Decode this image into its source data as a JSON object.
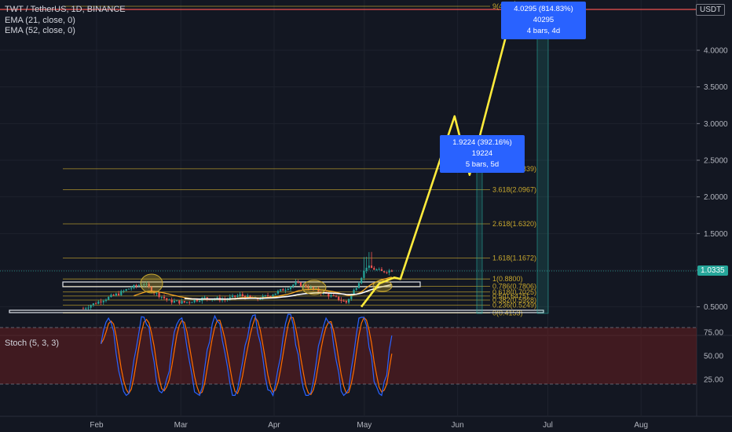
{
  "header": {
    "symbol_line": "TWT / TetherUS, 1D, BINANCE",
    "ema21": "EMA (21, close, 0)",
    "ema52": "EMA (52, close, 0)",
    "stoch_label": "Stoch (5, 3, 3)",
    "currency_badge": "USDT",
    "last_price": "1.0335"
  },
  "measures": [
    {
      "line1": "4.0295 (814.83%) 40295",
      "line2": "4 bars, 4d"
    },
    {
      "line1": "1.9224 (392.16%) 19224",
      "line2": "5 bars, 5d"
    }
  ],
  "colors": {
    "background": "#131722",
    "up": "#26a69a",
    "down": "#ef5350",
    "fib": "#c8a82e",
    "arrow": "#ffeb3b",
    "stoch_k": "#2962ff",
    "stoch_d": "#ff6d00",
    "measure": "#2962ff"
  },
  "chart_data": {
    "type": "candlestick",
    "y_axis": {
      "ticks": [
        0.5,
        1.0,
        1.5,
        2.0,
        2.5,
        3.0,
        3.5,
        4.0
      ],
      "tick_labels": [
        "0.5000",
        "1.0000",
        "1.5000",
        "2.0000",
        "2.5000",
        "3.0000",
        "3.5000",
        "4.0000"
      ],
      "ylim": [
        0.3,
        4.7
      ]
    },
    "x_axis": {
      "ticks": [
        "Feb",
        "Mar",
        "Apr",
        "May",
        "Jun",
        "Jul",
        "Aug"
      ]
    },
    "fib_levels": [
      {
        "label": "0(0.4153)",
        "value": 0.4153
      },
      {
        "label": "0.236(0.5249)",
        "value": 0.5249
      },
      {
        "label": "0.382(0.5928)",
        "value": 0.5928
      },
      {
        "label": "0.5(0.6475)",
        "value": 0.6475
      },
      {
        "label": "0.618(0.7025)",
        "value": 0.7025
      },
      {
        "label": "0.786(0.7806)",
        "value": 0.7806
      },
      {
        "label": "1(0.8800)",
        "value": 0.88
      },
      {
        "label": "1.618(1.1672)",
        "value": 1.1672
      },
      {
        "label": "2.618(1.6320)",
        "value": 1.632
      },
      {
        "label": "3.618(2.0967)",
        "value": 2.0967
      },
      {
        "label": "4.236(2.3839)",
        "value": 2.3839
      },
      {
        "label": "9(4",
        "value": 4.6
      }
    ],
    "projection_path": [
      {
        "date": "2021-04-30",
        "value": 0.5
      },
      {
        "date": "2021-05-06",
        "value": 0.82
      },
      {
        "date": "2021-05-11",
        "value": 0.9
      },
      {
        "date": "2021-05-13",
        "value": 0.88
      },
      {
        "date": "2021-05-31",
        "value": 3.1
      },
      {
        "date": "2021-06-05",
        "value": 2.3
      },
      {
        "date": "2021-06-20",
        "value": 4.65
      },
      {
        "date": "2021-06-24",
        "value": 4.4
      }
    ],
    "stoch": {
      "levels": [
        80,
        20
      ],
      "ticks": [
        75,
        50,
        25
      ],
      "tick_labels": [
        "75.00",
        "50.00",
        "25.00"
      ]
    }
  }
}
